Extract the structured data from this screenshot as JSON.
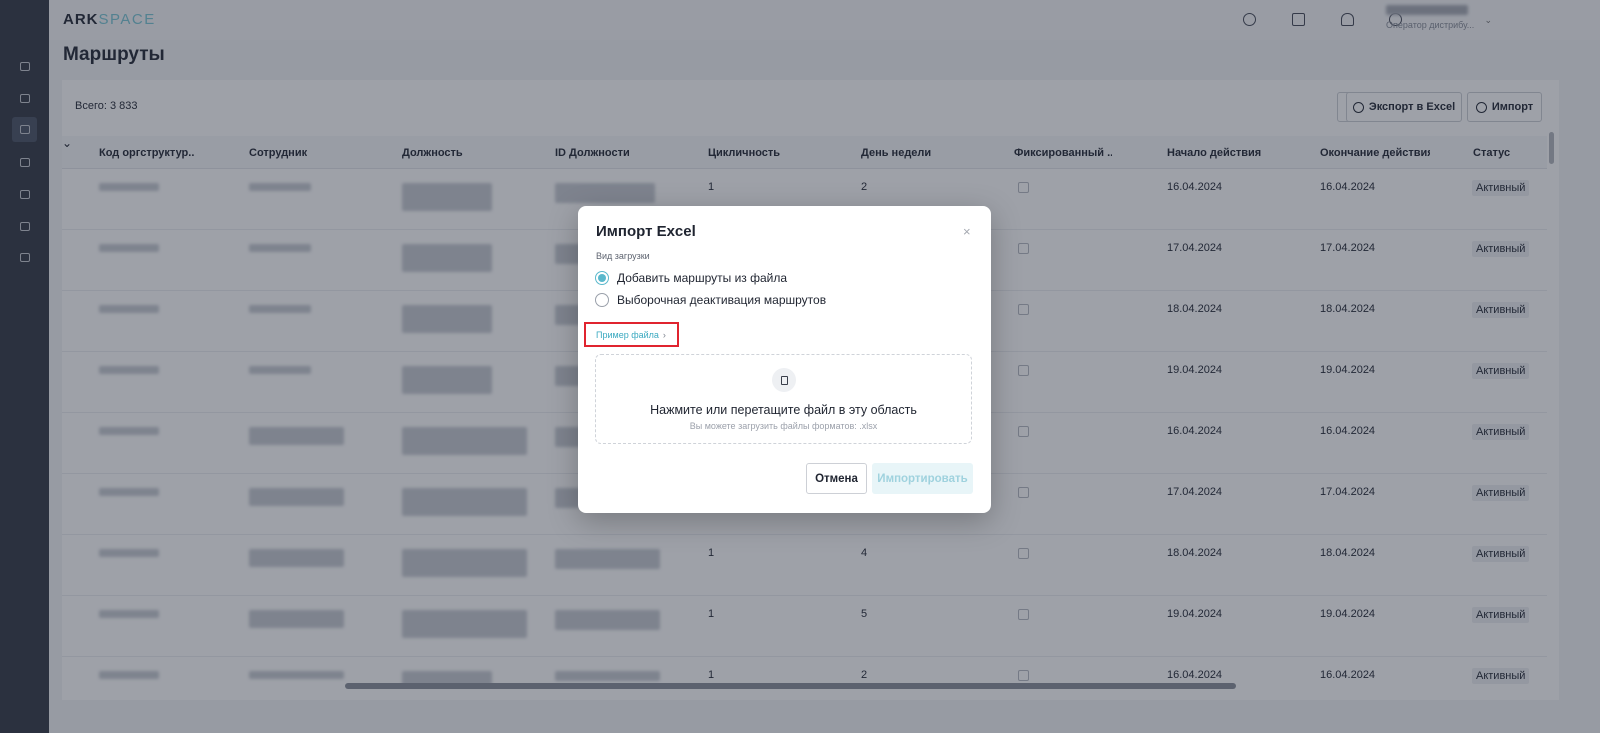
{
  "app": {
    "logo_main": "ARK",
    "logo_accent": "SPACE"
  },
  "user": {
    "role": "Оператор дистрибу..."
  },
  "page": {
    "title": "Маршруты",
    "total": "Всего: 3 833"
  },
  "toolbar": {
    "export_label": "Экспорт в Excel",
    "import_label": "Импорт"
  },
  "table": {
    "columns": [
      "Код оргструктур...",
      "Сотрудник",
      "Должность",
      "ID Должности",
      "Цикличность",
      "День недели",
      "Фиксированный ...",
      "Начало действия",
      "Окончание действия",
      "Статус"
    ],
    "rows": [
      {
        "cycle": "1",
        "day": "2",
        "start": "16.04.2024",
        "end": "16.04.2024",
        "status": "Активный"
      },
      {
        "cycle": "",
        "day": "",
        "start": "17.04.2024",
        "end": "17.04.2024",
        "status": "Активный"
      },
      {
        "cycle": "",
        "day": "",
        "start": "18.04.2024",
        "end": "18.04.2024",
        "status": "Активный"
      },
      {
        "cycle": "",
        "day": "",
        "start": "19.04.2024",
        "end": "19.04.2024",
        "status": "Активный"
      },
      {
        "cycle": "",
        "day": "",
        "start": "16.04.2024",
        "end": "16.04.2024",
        "status": "Активный"
      },
      {
        "cycle": "",
        "day": "",
        "start": "17.04.2024",
        "end": "17.04.2024",
        "status": "Активный"
      },
      {
        "cycle": "1",
        "day": "4",
        "start": "18.04.2024",
        "end": "18.04.2024",
        "status": "Активный"
      },
      {
        "cycle": "1",
        "day": "5",
        "start": "19.04.2024",
        "end": "19.04.2024",
        "status": "Активный"
      },
      {
        "cycle": "1",
        "day": "2",
        "start": "16.04.2024",
        "end": "16.04.2024",
        "status": "Активный"
      }
    ]
  },
  "modal": {
    "title": "Импорт Excel",
    "close": "×",
    "load_type_label": "Вид загрузки",
    "options": [
      "Добавить маршруты из файла",
      "Выборочная деактивация маршрутов"
    ],
    "selected_option": 0,
    "example_link": "Пример файла",
    "dropzone_main": "Нажмите или перетащите файл в эту область",
    "dropzone_hint": "Вы можете загрузить файлы форматов: .xlsx",
    "cancel_label": "Отмена",
    "import_label": "Импортировать"
  },
  "colors": {
    "accent": "#5ab8cc",
    "highlight": "#e0242f",
    "sidebar": "#3a3e4a"
  },
  "icons": [
    "list-icon",
    "database-icon",
    "layout-icon",
    "pie-chart-icon",
    "users-icon",
    "gear-icon",
    "calendar-icon",
    "chat-icon",
    "grid-icon",
    "bell-icon",
    "sync-icon",
    "search-icon",
    "file-icon"
  ]
}
